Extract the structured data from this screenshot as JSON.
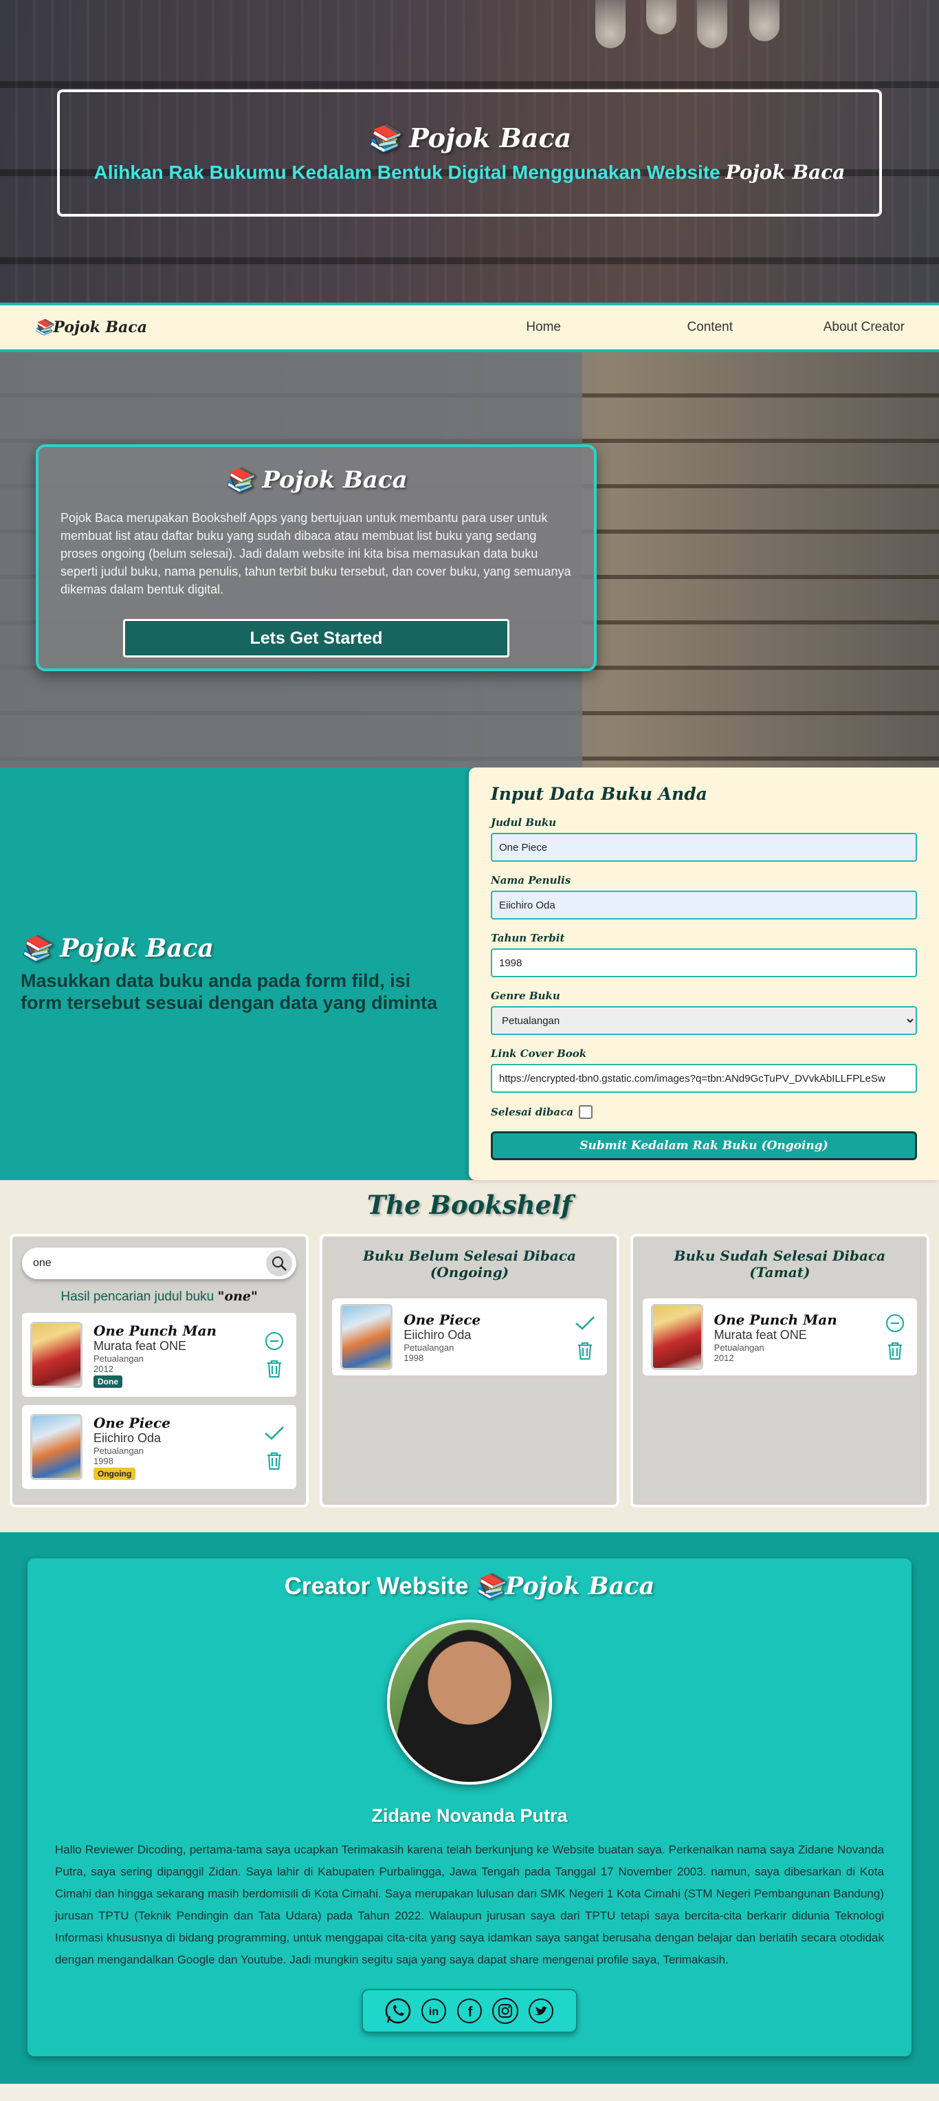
{
  "hero": {
    "title": "📚 Pojok Baca",
    "subtitle_text": "Alihkan Rak Bukumu Kedalam Bentuk Digital Menggunakan Website",
    "subtitle_brand": "Pojok Baca"
  },
  "nav": {
    "logo": "📚Pojok Baca",
    "links": [
      "Home",
      "Content",
      "About Creator"
    ]
  },
  "intro": {
    "title": "📚 Pojok Baca",
    "text": "Pojok Baca merupakan Bookshelf Apps yang bertujuan untuk membantu para user untuk membuat list atau daftar buku yang sudah dibaca atau membuat list buku yang sedang proses ongoing (belum selesai). Jadi dalam website ini kita bisa memasukan data buku seperti judul buku, nama penulis, tahun terbit buku tersebut, dan cover buku, yang semuanya dikemas dalam bentuk digital.",
    "button": "Lets Get Started"
  },
  "input_section": {
    "brand": "📚 Pojok Baca",
    "description": "Masukkan data buku anda pada form fild, isi form tersebut sesuai dengan data yang diminta"
  },
  "form": {
    "title": "Input Data Buku Anda",
    "title_label": "Judul Buku",
    "title_value": "One Piece",
    "author_label": "Nama Penulis",
    "author_value": "Eiichiro Oda",
    "year_label": "Tahun Terbit",
    "year_value": "1998",
    "genre_label": "Genre Buku",
    "genre_value": "Petualangan",
    "cover_label": "Link Cover Book",
    "cover_value": "https://encrypted-tbn0.gstatic.com/images?q=tbn:ANd9GcTuPV_DVvkAbILLFPLeSw",
    "done_label": "Selesai dibaca",
    "submit": "Submit Kedalam Rak Buku  (Ongoing)"
  },
  "bookshelf": {
    "title": "The Bookshelf",
    "search_value": "one",
    "result_prefix": "Hasil pencarian judul buku",
    "result_query": "\"one\"",
    "ongoing_title": "Buku Belum Selesai Dibaca (Ongoing)",
    "done_title": "Buku Sudah Selesai Dibaca (Tamat)",
    "search_results": [
      {
        "title": "One Punch Man",
        "author": "Murata feat ONE",
        "genre": "Petualangan",
        "year": "2012",
        "status": "Done"
      },
      {
        "title": "One Piece",
        "author": "Eiichiro Oda",
        "genre": "Petualangan",
        "year": "1998",
        "status": "Ongoing"
      }
    ],
    "ongoing_books": [
      {
        "title": "One Piece",
        "author": "Eiichiro Oda",
        "genre": "Petualangan",
        "year": "1998"
      }
    ],
    "done_books": [
      {
        "title": "One Punch Man",
        "author": "Murata feat ONE",
        "genre": "Petualangan",
        "year": "2012"
      }
    ]
  },
  "creator": {
    "title_text": "Creator Website",
    "title_brand": "📚Pojok Baca",
    "name": "Zidane Novanda Putra",
    "bio": "Hallo Reviewer Dicoding, pertama-tama saya ucapkan Terimakasih karena telah berkunjung ke Website buatan saya. Perkenalkan nama saya Zidane Novanda Putra, saya sering dipanggil Zidan. Saya lahir di Kabupaten Purbalingga, Jawa Tengah pada Tanggal 17 November 2003. namun, saya dibesarkan di Kota Cimahi dan hingga sekarang masih berdomisili di Kota Cimahi. Saya merupakan lulusan dari SMK Negeri 1 Kota Cimahi (STM Negeri Pembangunan Bandung) jurusan TPTU (Teknik Pendingin dan Tata Udara) pada Tahun 2022. Walaupun jurusan saya dari TPTU tetapi saya bercita-cita berkarir didunia Teknologi Informasi khususnya di bidang programming, untuk menggapai cita-cita yang saya idamkan saya sangat berusaha dengan belajar dan berlatih secara otodidak dengan mengandalkan Google dan Youtube. Jadi mungkin segitu saja yang saya dapat share mengenai profile saya, Terimakasih.",
    "socials": [
      "whatsapp-icon",
      "linkedin-icon",
      "facebook-icon",
      "instagram-icon",
      "twitter-icon"
    ]
  },
  "colors": {
    "teal": "#14a69c",
    "dark_teal": "#17655f",
    "cream": "#fdf6dc",
    "cyan_text": "#3ee7e0",
    "badge_ongoing": "#efc62a"
  }
}
